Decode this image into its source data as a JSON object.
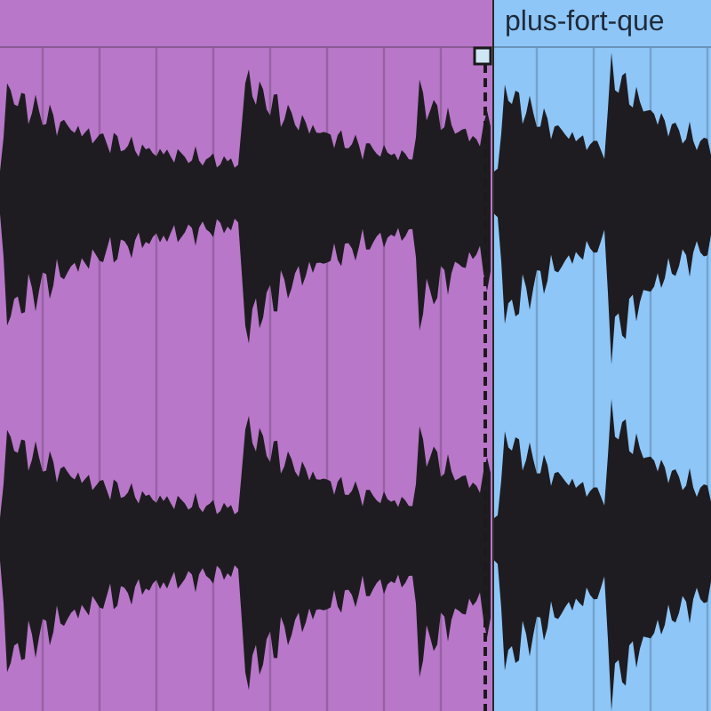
{
  "clips": [
    {
      "color": "#b877c8",
      "loop_end_marker": true
    },
    {
      "title": "plus-fort-que",
      "color": "#8ec6f8",
      "loop_end_marker": false
    }
  ]
}
